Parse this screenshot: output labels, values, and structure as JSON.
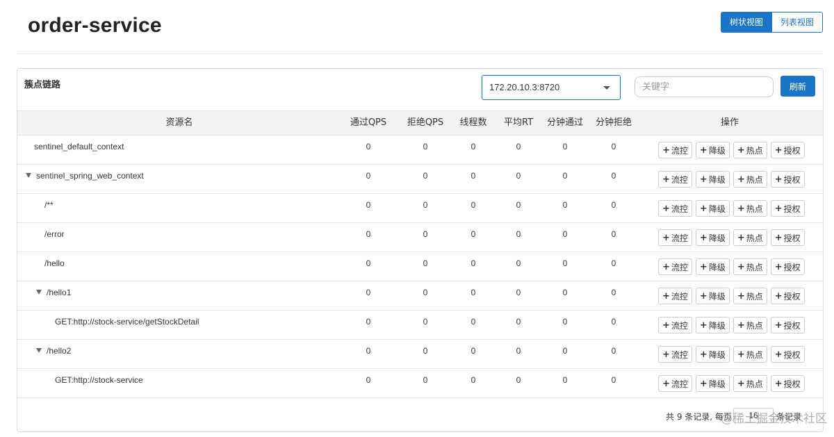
{
  "header": {
    "title": "order-service",
    "views": {
      "tree": "树状视图",
      "list": "列表视图"
    }
  },
  "panel": {
    "title": "簇点链路",
    "machine": "172.20.10.3:8720",
    "keyword_placeholder": "关键字",
    "refresh_label": "刷新"
  },
  "table": {
    "columns": [
      "资源名",
      "通过QPS",
      "拒绝QPS",
      "线程数",
      "平均RT",
      "分钟通过",
      "分钟拒绝",
      "操作"
    ],
    "actions": [
      "流控",
      "降级",
      "热点",
      "授权"
    ],
    "rows": [
      {
        "name": "sentinel_default_context",
        "level": 0,
        "expanded": false,
        "values": [
          "0",
          "0",
          "0",
          "0",
          "0",
          "0"
        ]
      },
      {
        "name": "sentinel_spring_web_context",
        "level": 0,
        "expanded": true,
        "values": [
          "0",
          "0",
          "0",
          "0",
          "0",
          "0"
        ]
      },
      {
        "name": "/**",
        "level": 1,
        "expanded": false,
        "values": [
          "0",
          "0",
          "0",
          "0",
          "0",
          "0"
        ]
      },
      {
        "name": "/error",
        "level": 1,
        "expanded": false,
        "values": [
          "0",
          "0",
          "0",
          "0",
          "0",
          "0"
        ]
      },
      {
        "name": "/hello",
        "level": 1,
        "expanded": false,
        "values": [
          "0",
          "0",
          "0",
          "0",
          "0",
          "0"
        ]
      },
      {
        "name": "/hello1",
        "level": 1,
        "expanded": true,
        "values": [
          "0",
          "0",
          "0",
          "0",
          "0",
          "0"
        ]
      },
      {
        "name": "GET:http://stock-service/getStockDetail",
        "level": 2,
        "expanded": false,
        "values": [
          "0",
          "0",
          "0",
          "0",
          "0",
          "0"
        ]
      },
      {
        "name": "/hello2",
        "level": 1,
        "expanded": true,
        "values": [
          "0",
          "0",
          "0",
          "0",
          "0",
          "0"
        ]
      },
      {
        "name": "GET:http://stock-service",
        "level": 2,
        "expanded": false,
        "values": [
          "0",
          "0",
          "0",
          "0",
          "0",
          "0"
        ]
      }
    ]
  },
  "footer": {
    "total": "共 9 条记录, 每页",
    "page_size": "16",
    "suffix": "条记录"
  },
  "watermark": "@稀土掘金技术社区",
  "colors": {
    "primary": "#1b74c5",
    "header_bg": "#f2f3f5",
    "border": "#dddddd"
  }
}
